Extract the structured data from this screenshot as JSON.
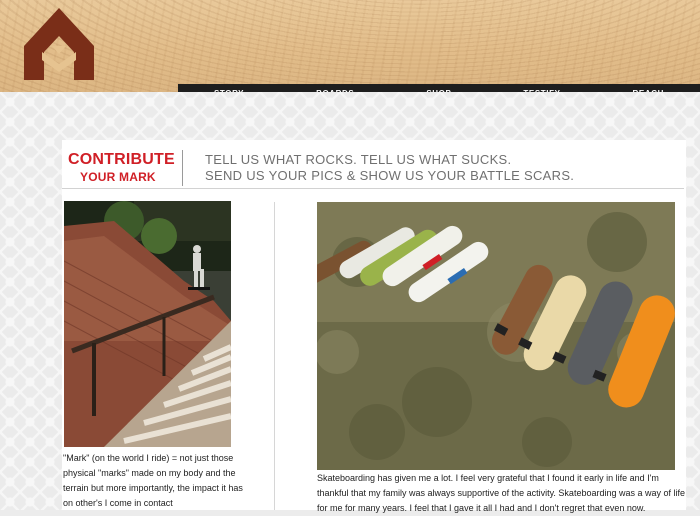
{
  "nav": {
    "items": [
      {
        "label": "STORY"
      },
      {
        "label": "BOARDS"
      },
      {
        "label": "SHOP"
      },
      {
        "label": "TESTIFY"
      },
      {
        "label": "REACH"
      }
    ]
  },
  "page": {
    "title_line1": "CONTRIBUTE",
    "title_line2": "YOUR MARK",
    "tagline_line1": "TELL US WHAT ROCKS. TELL US WHAT SUCKS.",
    "tagline_line2": "SEND US YOUR PICS & SHOW US YOUR BATTLE SCARS."
  },
  "left_caption": "\"Mark\" (on the world I ride) = not just those physical \"marks\" made on my body and the terrain but more importantly, the impact it has on other's I come in contact",
  "right_caption": "Skateboarding has given me a lot. I feel very grateful that I found it early in life and I'm thankful that my family was always supportive of the activity. Skateboarding was a way of life for me for many years. I feel that I gave it all I had and I don't regret that even now.",
  "colors": {
    "accent_red": "#d01f26",
    "nav_bg": "#1e1e1e",
    "logo_brown": "#7a2e18"
  },
  "icons": {
    "logo": "mark-logo-icon"
  }
}
